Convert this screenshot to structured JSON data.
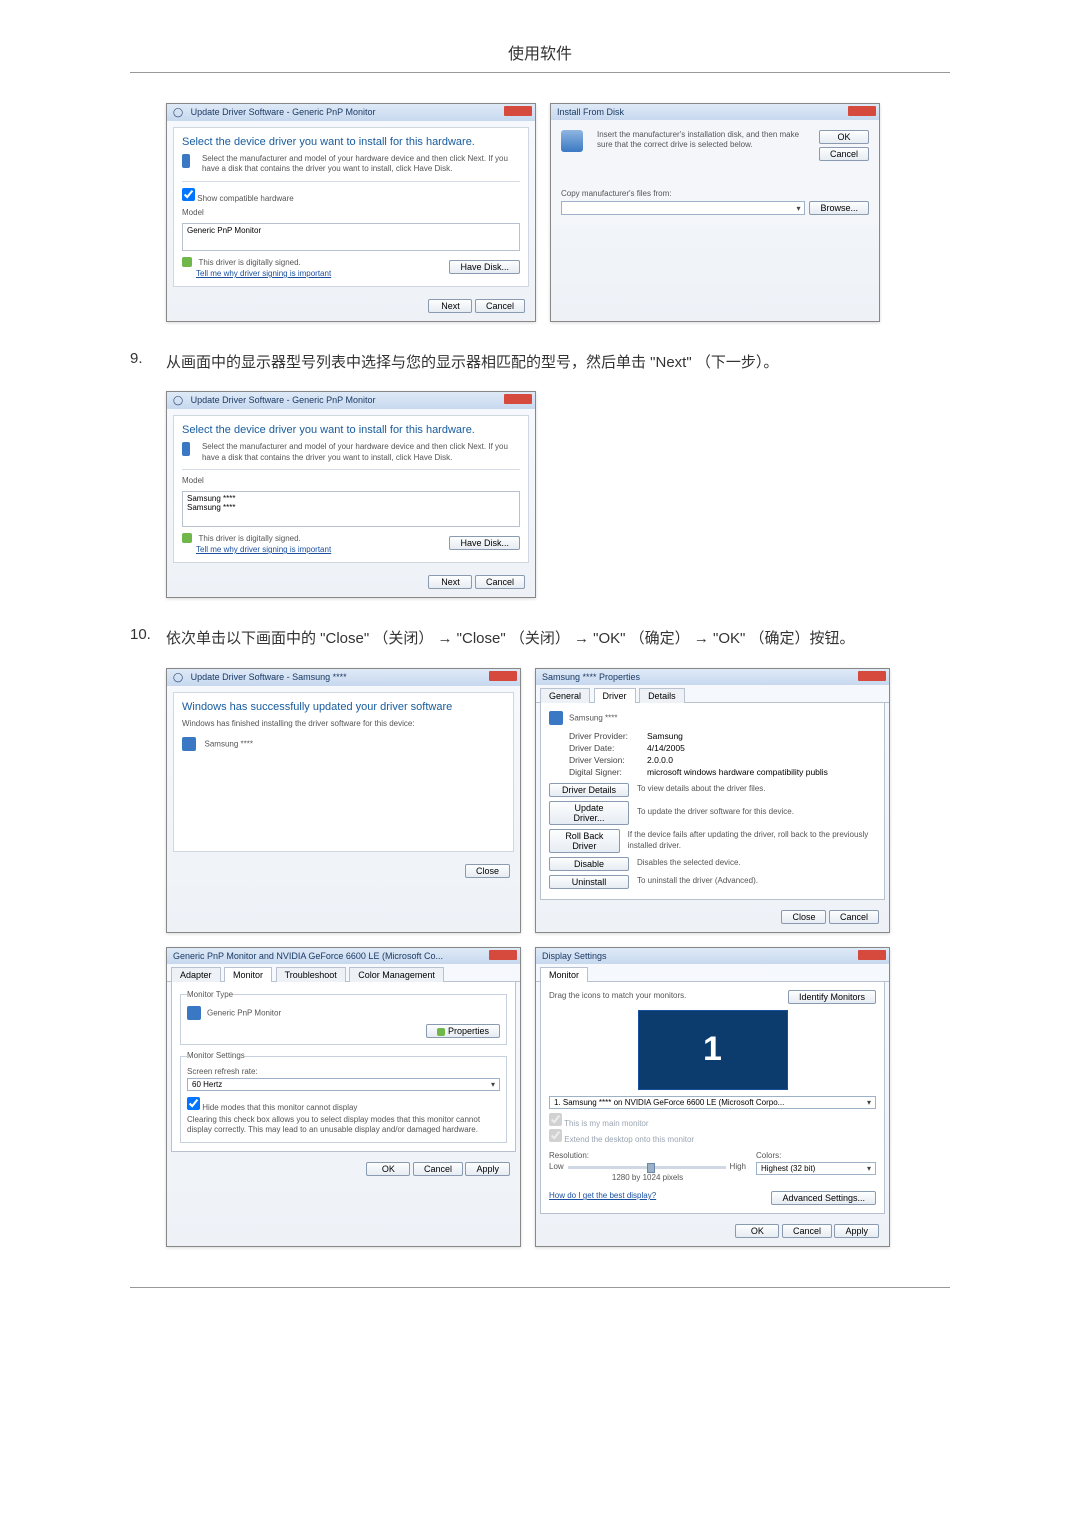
{
  "page_title": "使用软件",
  "step9": {
    "num": "9.",
    "text_prefix": "从画面中的显示器型号列表中选择与您的显示器相匹配的型号，然后单击 \"",
    "next_label": "Next",
    "text_suffix": "\" （下一步）。"
  },
  "dlg_select1": {
    "breadcrumb": "Update Driver Software - Generic PnP Monitor",
    "heading": "Select the device driver you want to install for this hardware.",
    "subtext": "Select the manufacturer and model of your hardware device and then click Next. If you have a disk that contains the driver you want to install, click Have Disk.",
    "show_compat": "Show compatible hardware",
    "col_model": "Model",
    "item1": "Generic PnP Monitor",
    "signed": "This driver is digitally signed.",
    "signed_link": "Tell me why driver signing is important",
    "have_disk": "Have Disk...",
    "next": "Next",
    "cancel": "Cancel"
  },
  "dlg_install_disk": {
    "title": "Install From Disk",
    "msg": "Insert the manufacturer's installation disk, and then make sure that the correct drive is selected below.",
    "ok": "OK",
    "cancel": "Cancel",
    "copy_label": "Copy manufacturer's files from:",
    "path": "",
    "browse": "Browse..."
  },
  "dlg_select2": {
    "breadcrumb": "Update Driver Software - Generic PnP Monitor",
    "heading": "Select the device driver you want to install for this hardware.",
    "subtext": "Select the manufacturer and model of your hardware device and then click Next. If you have a disk that contains the driver you want to install, click Have Disk.",
    "col_model": "Model",
    "item1": "Samsung ****",
    "item2": "Samsung ****",
    "signed": "This driver is digitally signed.",
    "signed_link": "Tell me why driver signing is important",
    "have_disk": "Have Disk...",
    "next": "Next",
    "cancel": "Cancel"
  },
  "step10": {
    "num": "10.",
    "text": "依次单击以下画面中的 \"Close\" （关闭） → \"Close\" （关闭） → \"OK\" （确定） → \"OK\" （确定）按钮。"
  },
  "dlg_finished": {
    "breadcrumb": "Update Driver Software - Samsung ****",
    "heading": "Windows has successfully updated your driver software",
    "subtext": "Windows has finished installing the driver software for this device:",
    "device": "Samsung ****",
    "close": "Close"
  },
  "dlg_props": {
    "title": "Samsung **** Properties",
    "tab_general": "General",
    "tab_driver": "Driver",
    "tab_details": "Details",
    "device": "Samsung ****",
    "lbl_provider": "Driver Provider:",
    "val_provider": "Samsung",
    "lbl_date": "Driver Date:",
    "val_date": "4/14/2005",
    "lbl_version": "Driver Version:",
    "val_version": "2.0.0.0",
    "lbl_signer": "Digital Signer:",
    "val_signer": "microsoft windows hardware compatibility publis",
    "btn_details": "Driver Details",
    "txt_details": "To view details about the driver files.",
    "btn_update": "Update Driver...",
    "txt_update": "To update the driver software for this device.",
    "btn_rollback": "Roll Back Driver",
    "txt_rollback": "If the device fails after updating the driver, roll back to the previously installed driver.",
    "btn_disable": "Disable",
    "txt_disable": "Disables the selected device.",
    "btn_uninstall": "Uninstall",
    "txt_uninstall": "To uninstall the driver (Advanced).",
    "close": "Close",
    "cancel": "Cancel"
  },
  "dlg_monitor": {
    "title": "Generic PnP Monitor and NVIDIA GeForce 6600 LE (Microsoft Co...",
    "tab_adapter": "Adapter",
    "tab_monitor": "Monitor",
    "tab_trouble": "Troubleshoot",
    "tab_color": "Color Management",
    "grp_type": "Monitor Type",
    "type_val": "Generic PnP Monitor",
    "btn_props": "Properties",
    "grp_settings": "Monitor Settings",
    "lbl_refresh": "Screen refresh rate:",
    "val_refresh": "60 Hertz",
    "chk_hide": "Hide modes that this monitor cannot display",
    "note": "Clearing this check box allows you to select display modes that this monitor cannot display correctly. This may lead to an unusable display and/or damaged hardware.",
    "ok": "OK",
    "cancel": "Cancel",
    "apply": "Apply"
  },
  "dlg_display": {
    "title": "Display Settings",
    "tab_monitor": "Monitor",
    "drag": "Drag the icons to match your monitors.",
    "identify": "Identify Monitors",
    "mon_num": "1",
    "mon_sel": "1. Samsung **** on NVIDIA GeForce 6600 LE (Microsoft Corpo...",
    "chk_main": "This is my main monitor",
    "chk_extend": "Extend the desktop onto this monitor",
    "lbl_res": "Resolution:",
    "lbl_colors": "Colors:",
    "res_low": "Low",
    "res_high": "High",
    "res_val": "1280 by 1024 pixels",
    "color_val": "Highest (32 bit)",
    "link_help": "How do I get the best display?",
    "btn_adv": "Advanced Settings...",
    "ok": "OK",
    "cancel": "Cancel",
    "apply": "Apply"
  }
}
